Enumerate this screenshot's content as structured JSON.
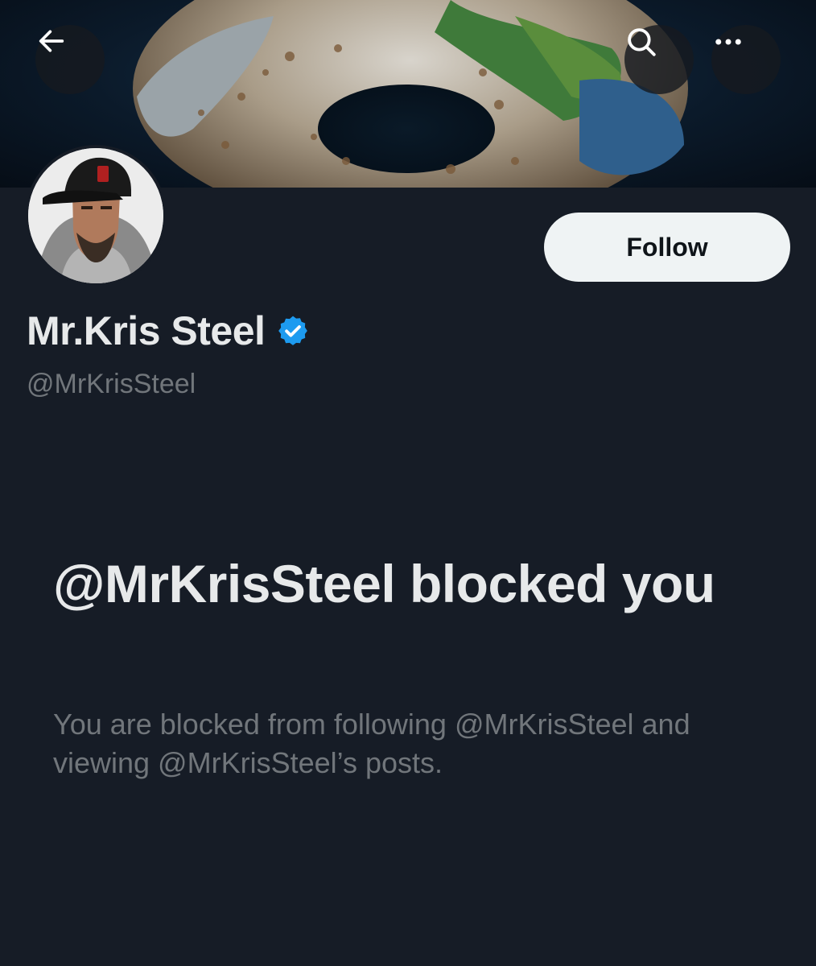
{
  "header": {
    "back_icon": "arrow-left-icon",
    "search_icon": "search-icon",
    "more_icon": "more-horizontal-icon"
  },
  "profile": {
    "display_name": "Mr.Kris Steel",
    "handle": "@MrKrisSteel",
    "verified": true,
    "verified_color": "#1d9bf0",
    "follow_label": "Follow"
  },
  "blocked": {
    "title": "@MrKrisSteel blocked you",
    "description": "You are blocked from following @MrKrisSteel and viewing @MrKrisSteel’s posts."
  },
  "colors": {
    "background": "#161c26",
    "primary_text": "#e7e9ea",
    "secondary_text": "#71767b",
    "button_bg": "#eff3f4"
  }
}
